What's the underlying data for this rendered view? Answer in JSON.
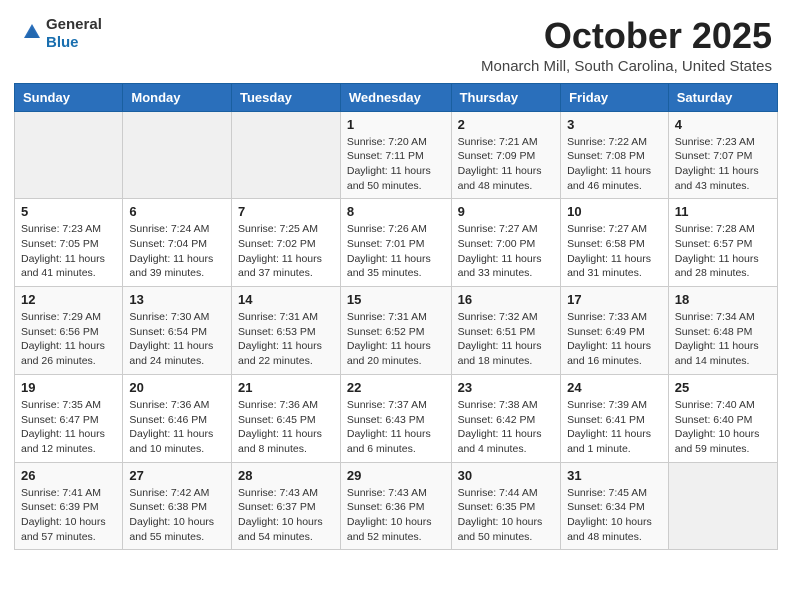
{
  "header": {
    "logo_general": "General",
    "logo_blue": "Blue",
    "month": "October 2025",
    "location": "Monarch Mill, South Carolina, United States"
  },
  "days_of_week": [
    "Sunday",
    "Monday",
    "Tuesday",
    "Wednesday",
    "Thursday",
    "Friday",
    "Saturday"
  ],
  "weeks": [
    [
      {
        "day": "",
        "info": ""
      },
      {
        "day": "",
        "info": ""
      },
      {
        "day": "",
        "info": ""
      },
      {
        "day": "1",
        "info": "Sunrise: 7:20 AM\nSunset: 7:11 PM\nDaylight: 11 hours and 50 minutes."
      },
      {
        "day": "2",
        "info": "Sunrise: 7:21 AM\nSunset: 7:09 PM\nDaylight: 11 hours and 48 minutes."
      },
      {
        "day": "3",
        "info": "Sunrise: 7:22 AM\nSunset: 7:08 PM\nDaylight: 11 hours and 46 minutes."
      },
      {
        "day": "4",
        "info": "Sunrise: 7:23 AM\nSunset: 7:07 PM\nDaylight: 11 hours and 43 minutes."
      }
    ],
    [
      {
        "day": "5",
        "info": "Sunrise: 7:23 AM\nSunset: 7:05 PM\nDaylight: 11 hours and 41 minutes."
      },
      {
        "day": "6",
        "info": "Sunrise: 7:24 AM\nSunset: 7:04 PM\nDaylight: 11 hours and 39 minutes."
      },
      {
        "day": "7",
        "info": "Sunrise: 7:25 AM\nSunset: 7:02 PM\nDaylight: 11 hours and 37 minutes."
      },
      {
        "day": "8",
        "info": "Sunrise: 7:26 AM\nSunset: 7:01 PM\nDaylight: 11 hours and 35 minutes."
      },
      {
        "day": "9",
        "info": "Sunrise: 7:27 AM\nSunset: 7:00 PM\nDaylight: 11 hours and 33 minutes."
      },
      {
        "day": "10",
        "info": "Sunrise: 7:27 AM\nSunset: 6:58 PM\nDaylight: 11 hours and 31 minutes."
      },
      {
        "day": "11",
        "info": "Sunrise: 7:28 AM\nSunset: 6:57 PM\nDaylight: 11 hours and 28 minutes."
      }
    ],
    [
      {
        "day": "12",
        "info": "Sunrise: 7:29 AM\nSunset: 6:56 PM\nDaylight: 11 hours and 26 minutes."
      },
      {
        "day": "13",
        "info": "Sunrise: 7:30 AM\nSunset: 6:54 PM\nDaylight: 11 hours and 24 minutes."
      },
      {
        "day": "14",
        "info": "Sunrise: 7:31 AM\nSunset: 6:53 PM\nDaylight: 11 hours and 22 minutes."
      },
      {
        "day": "15",
        "info": "Sunrise: 7:31 AM\nSunset: 6:52 PM\nDaylight: 11 hours and 20 minutes."
      },
      {
        "day": "16",
        "info": "Sunrise: 7:32 AM\nSunset: 6:51 PM\nDaylight: 11 hours and 18 minutes."
      },
      {
        "day": "17",
        "info": "Sunrise: 7:33 AM\nSunset: 6:49 PM\nDaylight: 11 hours and 16 minutes."
      },
      {
        "day": "18",
        "info": "Sunrise: 7:34 AM\nSunset: 6:48 PM\nDaylight: 11 hours and 14 minutes."
      }
    ],
    [
      {
        "day": "19",
        "info": "Sunrise: 7:35 AM\nSunset: 6:47 PM\nDaylight: 11 hours and 12 minutes."
      },
      {
        "day": "20",
        "info": "Sunrise: 7:36 AM\nSunset: 6:46 PM\nDaylight: 11 hours and 10 minutes."
      },
      {
        "day": "21",
        "info": "Sunrise: 7:36 AM\nSunset: 6:45 PM\nDaylight: 11 hours and 8 minutes."
      },
      {
        "day": "22",
        "info": "Sunrise: 7:37 AM\nSunset: 6:43 PM\nDaylight: 11 hours and 6 minutes."
      },
      {
        "day": "23",
        "info": "Sunrise: 7:38 AM\nSunset: 6:42 PM\nDaylight: 11 hours and 4 minutes."
      },
      {
        "day": "24",
        "info": "Sunrise: 7:39 AM\nSunset: 6:41 PM\nDaylight: 11 hours and 1 minute."
      },
      {
        "day": "25",
        "info": "Sunrise: 7:40 AM\nSunset: 6:40 PM\nDaylight: 10 hours and 59 minutes."
      }
    ],
    [
      {
        "day": "26",
        "info": "Sunrise: 7:41 AM\nSunset: 6:39 PM\nDaylight: 10 hours and 57 minutes."
      },
      {
        "day": "27",
        "info": "Sunrise: 7:42 AM\nSunset: 6:38 PM\nDaylight: 10 hours and 55 minutes."
      },
      {
        "day": "28",
        "info": "Sunrise: 7:43 AM\nSunset: 6:37 PM\nDaylight: 10 hours and 54 minutes."
      },
      {
        "day": "29",
        "info": "Sunrise: 7:43 AM\nSunset: 6:36 PM\nDaylight: 10 hours and 52 minutes."
      },
      {
        "day": "30",
        "info": "Sunrise: 7:44 AM\nSunset: 6:35 PM\nDaylight: 10 hours and 50 minutes."
      },
      {
        "day": "31",
        "info": "Sunrise: 7:45 AM\nSunset: 6:34 PM\nDaylight: 10 hours and 48 minutes."
      },
      {
        "day": "",
        "info": ""
      }
    ]
  ]
}
